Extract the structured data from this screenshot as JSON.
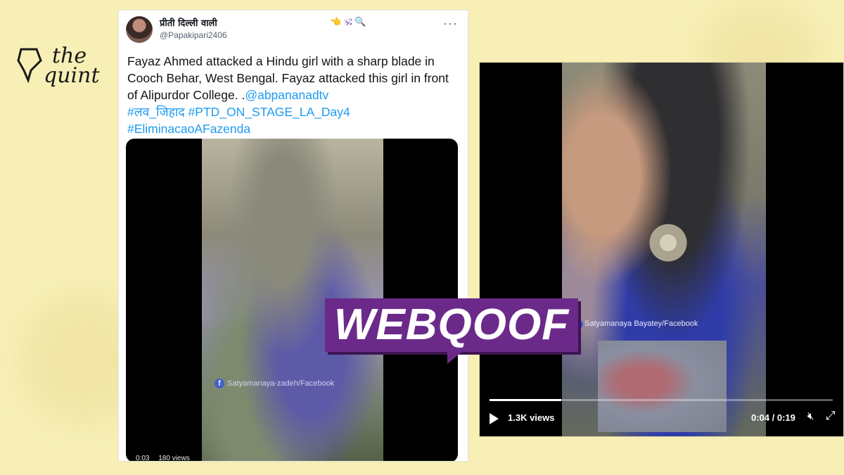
{
  "logo": {
    "line1": "the",
    "line2": "quint"
  },
  "tweet": {
    "display_name": "प्रीती दिल्ली वाली",
    "badges": "👈 🕉 🔍",
    "handle": "@Papakipari2406",
    "text_plain": "Fayaz Ahmed attacked a Hindu girl with a sharp blade in Cooch Behar, West Bengal. Fayaz attacked this girl in front of Alipurdor College. .",
    "mention": "@abpananadtv",
    "hashtag_1": "#लव_जिहाद",
    "hashtag_2": "#PTD_ON_STAGE_LA_Day4",
    "hashtag_3": "#EliminacaoAFazenda",
    "media": {
      "watermark": "Satyamanaya-zadeh/Facebook",
      "time": "0:03",
      "views": "180 views"
    }
  },
  "video": {
    "watermark": "Satyamanaya Bayatey/Facebook",
    "views": "1.3K views",
    "time": "0:04 / 0:19",
    "progress_fraction": 0.21
  },
  "badge": {
    "label": "WEBQOOF"
  },
  "icons": {
    "more": "more-icon",
    "play": "play-icon",
    "mute": "mute-icon",
    "fullscreen": "fullscreen-icon",
    "facebook": "facebook-icon"
  },
  "colors": {
    "background": "#f7efb5",
    "link": "#1d9bf0",
    "badge": "#6b2a8a"
  }
}
